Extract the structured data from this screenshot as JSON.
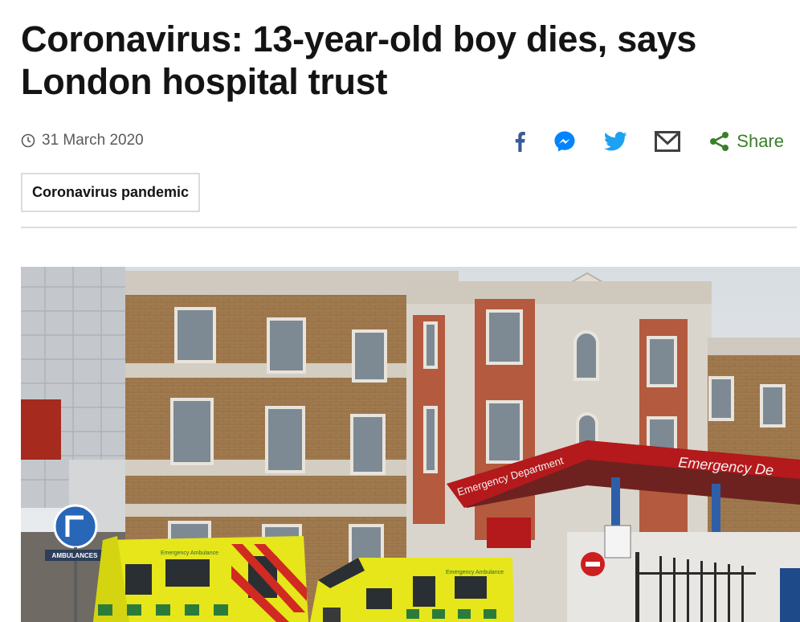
{
  "article": {
    "headline": "Coronavirus: 13-year-old boy dies, says London hospital trust",
    "date": "31 March 2020",
    "topic_tag": "Coronavirus pandemic"
  },
  "share": {
    "label": "Share",
    "icons": [
      "facebook-icon",
      "messenger-icon",
      "twitter-icon",
      "email-icon",
      "share-icon"
    ]
  },
  "image": {
    "canopy_sign": "Emergency Department",
    "canopy_sign_right": "Emergency De",
    "ambulance_text": "Emergency Ambulance",
    "side_sign": "AMBULANCES"
  },
  "colors": {
    "text": "#141414",
    "meta": "#5a5a5a",
    "share_green": "#3a7f2a",
    "facebook": "#3b5998",
    "messenger": "#0084ff",
    "twitter": "#1da1f2",
    "border": "#dcdcdc",
    "canopy_red": "#b4191c",
    "ambulance_yellow": "#e6e61a"
  }
}
